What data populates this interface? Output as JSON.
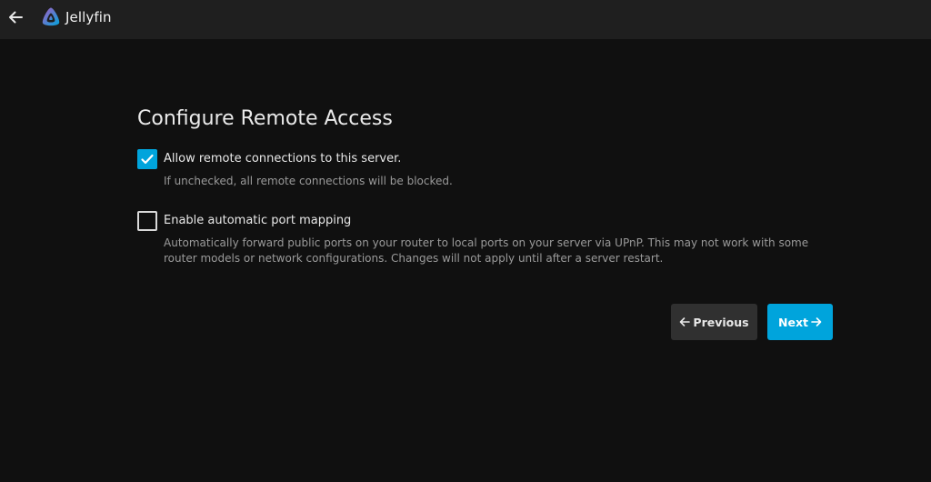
{
  "header": {
    "app_name": "Jellyfin",
    "back_icon": "arrow-left-icon",
    "logo_icon": "jellyfin-logo-icon"
  },
  "page": {
    "title": "Configure Remote Access"
  },
  "options": [
    {
      "label": "Allow remote connections to this server.",
      "description": "If unchecked, all remote connections will be blocked.",
      "checked": true
    },
    {
      "label": "Enable automatic port mapping",
      "description": "Automatically forward public ports on your router to local ports on your server via UPnP. This may not work with some router models or network configurations. Changes will not apply until after a server restart.",
      "checked": false
    }
  ],
  "buttons": {
    "previous_label": "Previous",
    "next_label": "Next"
  },
  "colors": {
    "accent": "#00a4dc",
    "background": "#101010",
    "header": "#1f1f1f",
    "secondary_button": "#303030"
  }
}
